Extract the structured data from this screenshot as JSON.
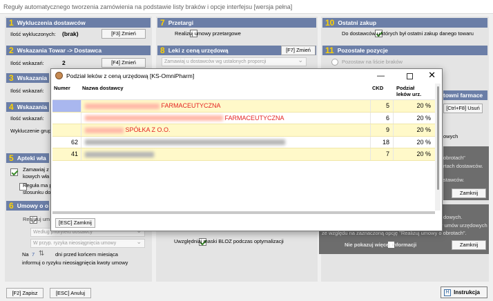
{
  "window": {
    "title": "Reguły automatycznego tworzenia zamówienia na podstawie listy braków i opcje interfejsu [wersja pełna]"
  },
  "sections": {
    "s1": {
      "num": "1",
      "title": "Wykluczenia dostawców",
      "label": "Ilość wykluczonych:",
      "value": "(brak)",
      "button": "[F3] Zmień"
    },
    "s2": {
      "num": "2",
      "title": "Wskazania Towar -> Dostawca",
      "label": "Ilość wskazań:",
      "value": "2",
      "button": "[F4] Zmień"
    },
    "s3": {
      "num": "3",
      "title": "Wskazania",
      "label": "Ilość wskazań:"
    },
    "s4": {
      "num": "4",
      "title": "Wskazania",
      "label": "Ilość wskazań:",
      "label2": "Wykluczenie grup"
    },
    "s5": {
      "num": "5",
      "title": "Apteki wła",
      "opt1": "Zamawiaj z",
      "opt1b": "kowych wła",
      "opt2": "Reguła ma p",
      "opt2b": "stosunku do"
    },
    "s6": {
      "num": "6",
      "title": "Umowy o o",
      "opt1": "Realizuj um",
      "combo1": "Według priorytetu dostawcy",
      "combo2": "W przyp. ryzyka nieosiągnięcia umowy",
      "days_prefix": "Na",
      "days_value": "7",
      "days_suffix": "dni przed końcem miesiąca",
      "days_line2": "informuj o ryzyku nieosiągnięcia kwoty umowy"
    },
    "s7": {
      "num": "7",
      "title": "Przetargi",
      "opt1": "Realizuj umowy przetargowe"
    },
    "s8": {
      "num": "8",
      "title": "Leki z ceną urzędową",
      "button": "[F7] Zmień",
      "combo": "Zamawiaj u dostawców wg ustalonych proporcji"
    },
    "s10": {
      "num": "10",
      "title": "Ostatni zakup",
      "opt1": "Do dostawców u których był ostatni zakup danego towaru"
    },
    "s11": {
      "num": "11",
      "title": "Pozostałe pozycje",
      "opt1": "Pozostaw na liście braków"
    },
    "s12": {
      "title_partial": "towni farmace",
      "button": "[Ctrl+F8] Usuń"
    },
    "right_note": {
      "partial1": "owych"
    },
    "bloz": {
      "label": "Uwzględniaj maski BLOZ podczas optymalizacji"
    }
  },
  "info1": {
    "line1": "obrotach\"",
    "line2": "rtach dostawców.",
    "line3": "stawców.",
    "button": "Zamknij"
  },
  "info2": {
    "line1": "dowych.",
    "line2": "w umów urzędowych",
    "line3": "ze względu na zaznaczoną opcję \"Realizuj umowy o obrotach\".",
    "check": "Nie pokazuj więcej informacji",
    "button": "Zamknij"
  },
  "dialog": {
    "title": "Podział leków z ceną urzędową [KS-OmniPharm]",
    "columns": {
      "num": "Numer",
      "name": "Nazwa dostawcy",
      "ckd": "CKD",
      "pct1": "Podział",
      "pct2": "leków urz."
    },
    "rows": [
      {
        "num": "",
        "name_visible": "FARMACEUTYCZNA",
        "ckd": "5",
        "pct": "20 %"
      },
      {
        "num": "",
        "name_visible": "FARMACEUTYCZNA",
        "ckd": "6",
        "pct": "20 %"
      },
      {
        "num": "",
        "name_visible": "SPÓŁKA Z O.O.",
        "ckd": "9",
        "pct": "20 %"
      },
      {
        "num": "62",
        "name_visible": "",
        "ckd": "18",
        "pct": "20 %"
      },
      {
        "num": "41",
        "name_visible": "",
        "ckd": "7",
        "pct": "20 %"
      }
    ],
    "close_button": "[ESC] Zamknij"
  },
  "footer": {
    "save": "[F2] Zapisz",
    "cancel": "[ESC] Anuluj",
    "help": "Instrukcja"
  }
}
